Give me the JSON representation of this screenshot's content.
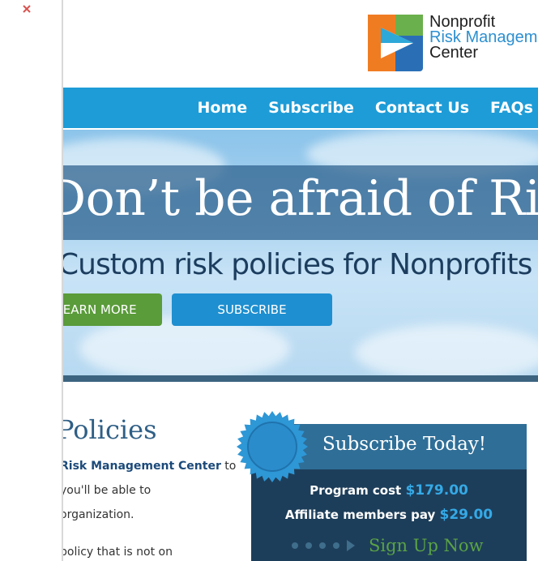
{
  "logo": {
    "line1": "Nonprofit",
    "line2": "Risk Management",
    "line3": "Center"
  },
  "nav": {
    "items": [
      {
        "label": "Home"
      },
      {
        "label": "Subscribe"
      },
      {
        "label": "Contact Us"
      },
      {
        "label": "FAQs"
      }
    ]
  },
  "hero": {
    "title": "Don’t be afraid of Risk",
    "subtitle": "Custom risk policies for Nonprofits",
    "learn_more": "LEARN MORE",
    "subscribe": "SUBSCRIBE"
  },
  "policies": {
    "title": "Policies",
    "line1_bold": "Risk Management Center",
    "line1_rest": " to",
    "line2": "you'll be able to",
    "line3": "organization.",
    "line4": "policy that is not on"
  },
  "subscribe_box": {
    "title": "Subscribe Today!",
    "program_cost_label": "Program cost ",
    "program_cost_value": "$179.00",
    "affiliate_label": "Affiliate members pay ",
    "affiliate_value": "$29.00",
    "cta": "Sign Up Now"
  },
  "colors": {
    "nav": "#1e9cd7",
    "learn_more": "#5a9b3a",
    "subscribe_button": "#1e8fd0",
    "subscribe_box": "#1d3e5a",
    "cta": "#5aa246"
  }
}
